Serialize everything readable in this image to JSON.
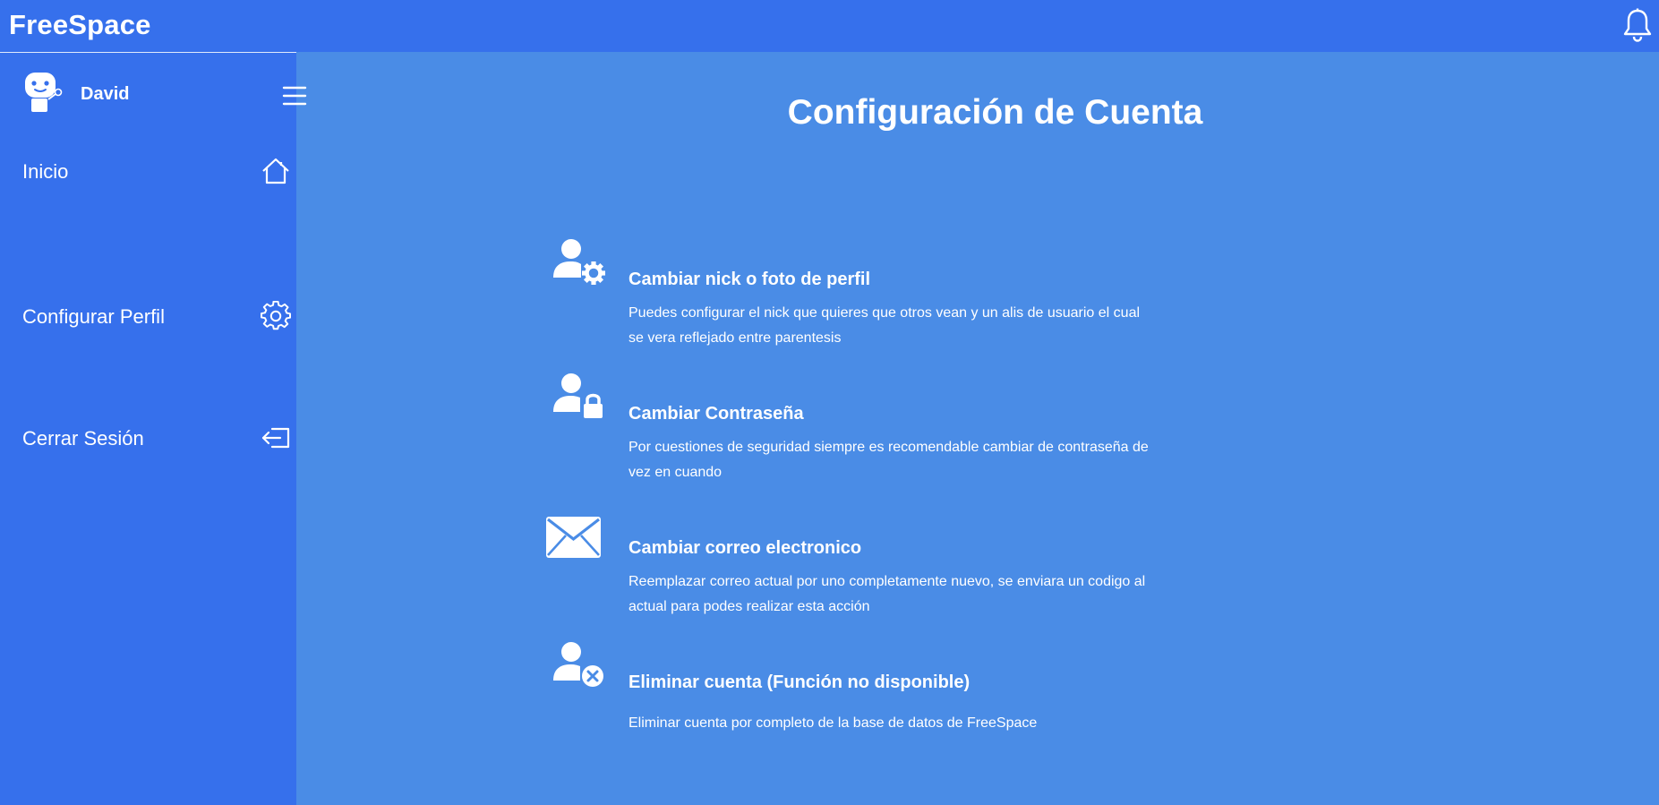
{
  "app": {
    "brand": "FreeSpace"
  },
  "header": {
    "notifications_icon": "bell-icon"
  },
  "sidebar": {
    "user": {
      "name": "David",
      "avatar_icon": "robot-avatar-icon"
    },
    "menu_icon": "hamburger-menu-icon",
    "items": [
      {
        "label": "Inicio",
        "icon": "home-icon"
      },
      {
        "label": "Configurar Perfil",
        "icon": "gear-icon"
      },
      {
        "label": "Cerrar Sesión",
        "icon": "logout-icon"
      }
    ]
  },
  "main": {
    "title": "Configuración de Cuenta",
    "options": [
      {
        "title": "Cambiar nick o foto de perfil",
        "description": "Puedes configurar el nick que quieres que otros vean y un alis de usuario el cual se vera reflejado entre parentesis",
        "icon": "user-gear-icon"
      },
      {
        "title": "Cambiar Contraseña",
        "description": "Por cuestiones de seguridad siempre es recomendable cambiar de contraseña de vez en cuando",
        "icon": "user-lock-icon"
      },
      {
        "title": "Cambiar correo electronico",
        "description": "Reemplazar correo actual por uno completamente nuevo, se enviara un codigo al actual para podes realizar esta acción",
        "icon": "envelope-icon"
      },
      {
        "title": "Eliminar cuenta (Función no disponible)",
        "description": "Eliminar cuenta por completo de la base de datos de FreeSpace",
        "icon": "user-remove-icon"
      }
    ]
  },
  "colors": {
    "header_bg": "#3670ec",
    "sidebar_bg": "#3670ec",
    "main_bg": "#4a8ce6",
    "text": "#ffffff"
  }
}
